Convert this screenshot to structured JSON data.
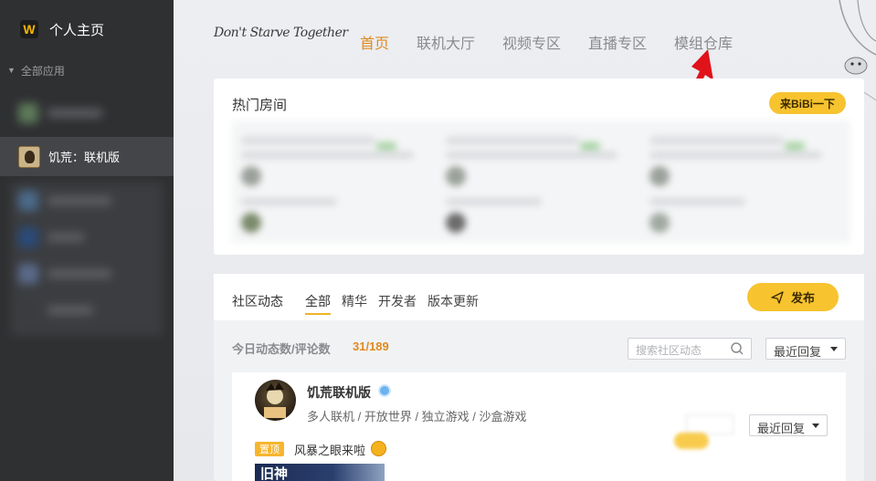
{
  "sidebar": {
    "title": "个人主页",
    "logo": "W",
    "section_label": "全部应用",
    "active_item": {
      "label": "饥荒：联机版",
      "icon": "dont-starve-icon"
    }
  },
  "topnav": {
    "brand": "Don't Starve Together",
    "items": [
      {
        "label": "首页",
        "active": true
      },
      {
        "label": "联机大厅",
        "active": false
      },
      {
        "label": "视频专区",
        "active": false
      },
      {
        "label": "直播专区",
        "active": false
      },
      {
        "label": "模组仓库",
        "active": false
      }
    ]
  },
  "hot_rooms": {
    "title": "热门房间",
    "bibi_button": "来BiBi一下"
  },
  "community": {
    "title": "社区动态",
    "tabs": [
      {
        "label": "全部",
        "active": true
      },
      {
        "label": "精华",
        "active": false
      },
      {
        "label": "开发者",
        "active": false
      },
      {
        "label": "版本更新",
        "active": false
      }
    ],
    "post_button": "发布",
    "stats_label": "今日动态数/评论数",
    "stats_value": "31/189",
    "search_placeholder": "搜索社区动态",
    "sort_select": "最近回复",
    "post": {
      "name": "饥荒联机版",
      "tags": "多人联机 / 开放世界 / 独立游戏 / 沙盒游戏",
      "pin_badge": "置顶",
      "pin_text": "风暴之眼来啦",
      "thumb_text": "旧神",
      "ghost_select": "最近回复"
    }
  },
  "colors": {
    "accent": "#f7c32e",
    "nav_active": "#e08a1e",
    "sidebar_bg": "#2f3032",
    "arrow": "#e0121a"
  }
}
